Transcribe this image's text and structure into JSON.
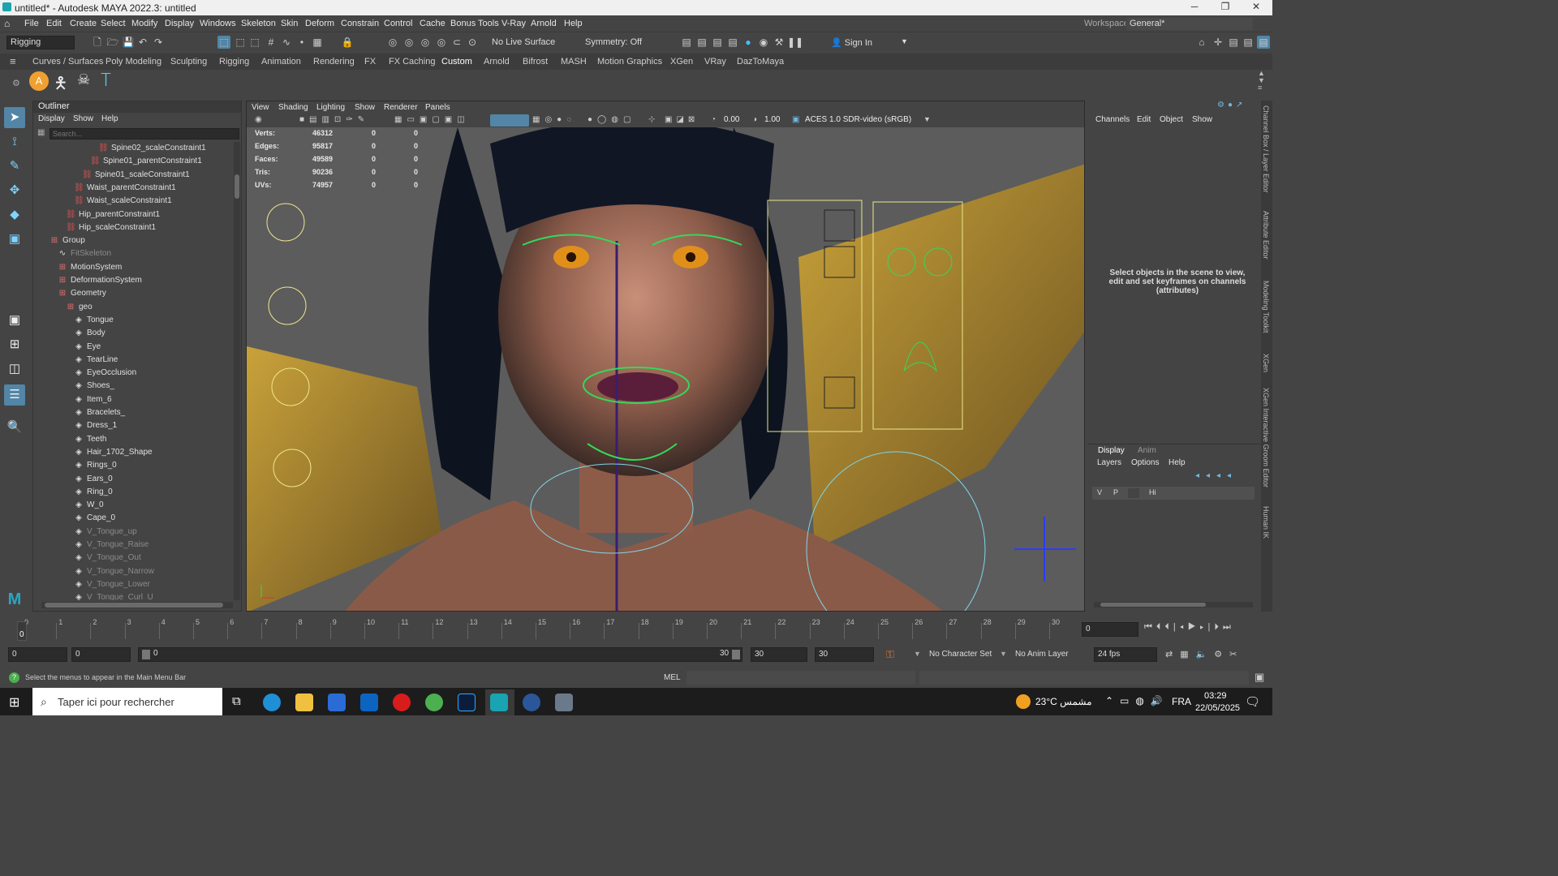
{
  "window": {
    "title": "untitled* - Autodesk MAYA 2022.3: untitled",
    "min": "─",
    "max": "❐",
    "close": "✕"
  },
  "menubar": {
    "items": [
      "File",
      "Edit",
      "Create",
      "Select",
      "Modify",
      "Display",
      "Windows",
      "Skeleton",
      "Skin",
      "Deform",
      "Constrain",
      "Control",
      "Cache",
      "Bonus Tools",
      "V-Ray",
      "Arnold",
      "Help"
    ],
    "workspace_label": "Workspace:",
    "workspace_value": "General*"
  },
  "statusline": {
    "menuset": "Rigging",
    "live_surface": "No Live Surface",
    "symmetry": "Symmetry: Off",
    "sign_in": "Sign In"
  },
  "shelf": {
    "tabs": [
      "Curves / Surfaces",
      "Poly Modeling",
      "Sculpting",
      "Rigging",
      "Animation",
      "Rendering",
      "FX",
      "FX Caching",
      "Custom",
      "Arnold",
      "Bifrost",
      "MASH",
      "Motion Graphics",
      "XGen",
      "VRay",
      "DazToMaya"
    ],
    "active_tab": "Custom"
  },
  "outliner": {
    "title": "Outliner",
    "menu": [
      "Display",
      "Show",
      "Help"
    ],
    "search_placeholder": "Search...",
    "items": [
      {
        "label": "Spine02_scaleConstraint1",
        "dim": false
      },
      {
        "label": "Spine01_parentConstraint1",
        "dim": false
      },
      {
        "label": "Spine01_scaleConstraint1",
        "dim": false
      },
      {
        "label": "Waist_parentConstraint1",
        "dim": false
      },
      {
        "label": "Waist_scaleConstraint1",
        "dim": false
      },
      {
        "label": "Hip_parentConstraint1",
        "dim": false
      },
      {
        "label": "Hip_scaleConstraint1",
        "dim": false
      },
      {
        "label": "Group",
        "dim": false
      },
      {
        "label": "FitSkeleton",
        "dim": true
      },
      {
        "label": "MotionSystem",
        "dim": false
      },
      {
        "label": "DeformationSystem",
        "dim": false
      },
      {
        "label": "Geometry",
        "dim": false
      },
      {
        "label": "geo",
        "dim": false
      },
      {
        "label": "Tongue",
        "dim": false
      },
      {
        "label": "Body",
        "dim": false
      },
      {
        "label": "Eye",
        "dim": false
      },
      {
        "label": "TearLine",
        "dim": false
      },
      {
        "label": "EyeOcclusion",
        "dim": false
      },
      {
        "label": "Shoes_",
        "dim": false
      },
      {
        "label": "Item_6",
        "dim": false
      },
      {
        "label": "Bracelets_",
        "dim": false
      },
      {
        "label": "Dress_1",
        "dim": false
      },
      {
        "label": "Teeth",
        "dim": false
      },
      {
        "label": "Hair_1702_Shape",
        "dim": false
      },
      {
        "label": "Rings_0",
        "dim": false
      },
      {
        "label": "Ears_0",
        "dim": false
      },
      {
        "label": "Ring_0",
        "dim": false
      },
      {
        "label": "W_0",
        "dim": false
      },
      {
        "label": "Cape_0",
        "dim": false
      },
      {
        "label": "V_Tongue_up",
        "dim": true
      },
      {
        "label": "V_Tongue_Raise",
        "dim": true
      },
      {
        "label": "V_Tongue_Out",
        "dim": true
      },
      {
        "label": "V_Tongue_Narrow",
        "dim": true
      },
      {
        "label": "V_Tongue_Lower",
        "dim": true
      },
      {
        "label": "V_Tongue_Curl_U",
        "dim": true
      }
    ]
  },
  "viewport": {
    "menu": [
      "View",
      "Shading",
      "Lighting",
      "Show",
      "Renderer",
      "Panels"
    ],
    "near_value": "0.00",
    "far_value": "1.00",
    "color_space": "ACES 1.0 SDR-video (sRGB)",
    "hud": [
      {
        "label": "Verts:",
        "v1": "46312",
        "v2": "0",
        "v3": "0"
      },
      {
        "label": "Edges:",
        "v1": "95817",
        "v2": "0",
        "v3": "0"
      },
      {
        "label": "Faces:",
        "v1": "49589",
        "v2": "0",
        "v3": "0"
      },
      {
        "label": "Tris:",
        "v1": "90236",
        "v2": "0",
        "v3": "0"
      },
      {
        "label": "UVs:",
        "v1": "74957",
        "v2": "0",
        "v3": "0"
      }
    ]
  },
  "channelbox": {
    "menu": [
      "Channels",
      "Edit",
      "Object",
      "Show"
    ],
    "hint": "Select objects in the scene to view, edit and set keyframes on channels (attributes)",
    "layer_tabs": [
      "Display",
      "Anim"
    ],
    "layer_menu": [
      "Layers",
      "Options",
      "Help"
    ],
    "layer_row": {
      "v": "V",
      "p": "P",
      "name": "Hi"
    }
  },
  "sidetabs": [
    "Channel Box / Layer Editor",
    "Attribute Editor",
    "Modeling Toolkit",
    "XGen",
    "XGen Interactive Groom Editor",
    "Human IK"
  ],
  "timeline": {
    "ticks": [
      "0",
      "1",
      "2",
      "3",
      "4",
      "5",
      "6",
      "7",
      "8",
      "9",
      "10",
      "11",
      "12",
      "13",
      "14",
      "15",
      "16",
      "17",
      "18",
      "19",
      "20",
      "21",
      "22",
      "23",
      "24",
      "25",
      "26",
      "27",
      "28",
      "29",
      "30"
    ],
    "current_frame": "0",
    "current_field": "0"
  },
  "range": {
    "start": "0",
    "anim_start": "0",
    "slider_start": "0",
    "slider_end": "30",
    "anim_end": "30",
    "end": "30",
    "character_set": "No Character Set",
    "anim_layer": "No Anim Layer",
    "fps": "24 fps"
  },
  "cmdline": {
    "help": "Select the menus to appear in the Main Menu Bar",
    "lang": "MEL"
  },
  "taskbar": {
    "search_placeholder": "Taper ici pour rechercher",
    "weather": "23°C مشمس",
    "lang": "FRA",
    "time": "03:29",
    "date": "22/05/2025"
  },
  "colors": {
    "accent": "#6fb7e0",
    "highlight": "#5285a6",
    "viewport_bg": "#5c5c5c"
  }
}
